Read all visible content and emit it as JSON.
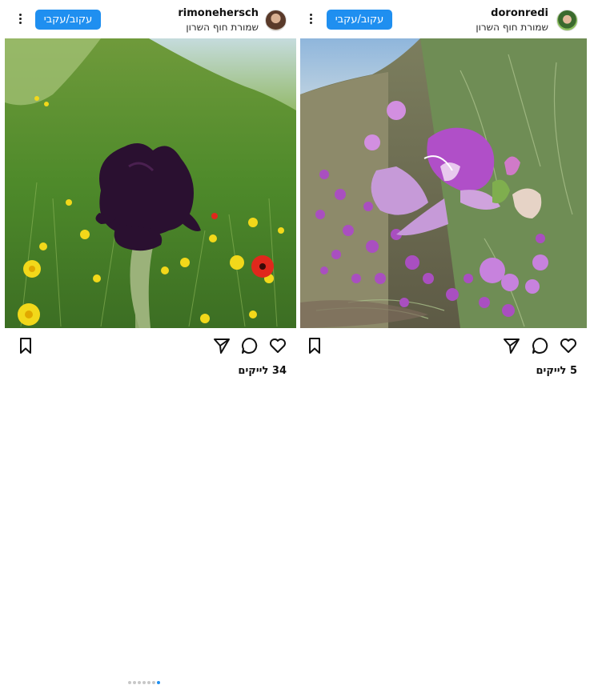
{
  "posts": [
    {
      "username": "rimonehersch",
      "location": "שמורת חוף השרון",
      "follow_label": "עקוב/עקבי",
      "likes": "34 לייקים",
      "carousel": {
        "count": 7,
        "active_index": 6
      },
      "icons": [
        "bookmark-icon",
        "share-icon",
        "comment-icon",
        "heart-icon",
        "more-options-icon"
      ]
    },
    {
      "username": "doronredi",
      "location": "שמורת חוף השרון",
      "follow_label": "עקוב/עקבי",
      "likes": "5 לייקים",
      "icons": [
        "bookmark-icon",
        "share-icon",
        "comment-icon",
        "heart-icon",
        "more-options-icon"
      ]
    }
  ],
  "colors": {
    "accent": "#1f8ff0",
    "text": "#111111",
    "iris": "#2a1030",
    "orchid": "#b24bc6"
  }
}
